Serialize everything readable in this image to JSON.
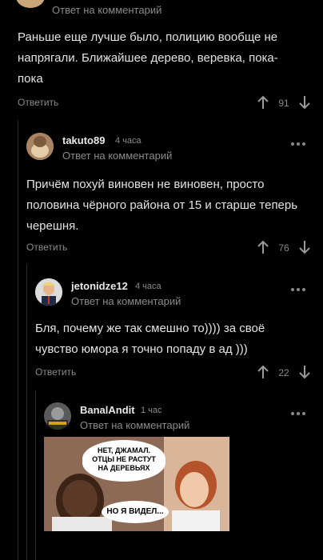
{
  "top_comment": {
    "reply_label": "Ответ на комментарий",
    "text": "Раньше еще лучше было, полицию вообще не\nнапрягали. Ближайшее дерево, веревка, пока-\nпока",
    "reply_button": "Ответить",
    "votes": "91"
  },
  "comments": [
    {
      "username": "takuto89",
      "time": "4 часа",
      "reply_label": "Ответ на комментарий",
      "text": "Причём похуй виновен не виновен, просто\nполовина чёрного района от 15 и старше теперь\nчерешня.",
      "reply_button": "Ответить",
      "votes": "76"
    },
    {
      "username": "jetonidze12",
      "time": "4 часа",
      "reply_label": "Ответ на комментарий",
      "text": "Бля, почему же так смешно то)))) за своё\nчувство юмора я точно попаду в ад )))",
      "reply_button": "Ответить",
      "votes": "22"
    },
    {
      "username": "BanalAndit",
      "time": "1 час",
      "reply_label": "Ответ на комментарий",
      "meme": {
        "bubble_top": "НЕТ, ДЖАМАЛ.\nОТЦЫ НЕ РАСТУТ\nНА ДЕРЕВЬЯХ",
        "bubble_bottom": "НО Я ВИДЕЛ..."
      }
    }
  ],
  "icons": {
    "upvote": "arrow-up-icon",
    "downvote": "arrow-down-icon",
    "more": "more-dots-icon"
  },
  "colors": {
    "background": "#000000",
    "text": "#e3e3e3",
    "muted": "#8a8a8a",
    "thread_line": "#2c2c2c"
  }
}
